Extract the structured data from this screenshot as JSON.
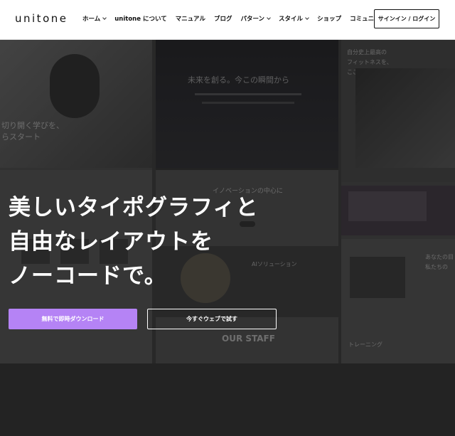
{
  "header": {
    "logo": "unitone",
    "nav": [
      {
        "label": "ホーム",
        "has_dropdown": true
      },
      {
        "label": "unitone について",
        "has_dropdown": false
      },
      {
        "label": "マニュアル",
        "has_dropdown": false
      },
      {
        "label": "ブログ",
        "has_dropdown": false
      },
      {
        "label": "パターン",
        "has_dropdown": true
      },
      {
        "label": "スタイル",
        "has_dropdown": true
      },
      {
        "label": "ショップ",
        "has_dropdown": false
      },
      {
        "label": "コミュニティ",
        "has_dropdown": true
      }
    ],
    "signin_label": "サインイン / ログイン"
  },
  "hero": {
    "headline": [
      "美しいタイポグラフィと",
      "自由なレイアウトを",
      "ノーコードで。"
    ],
    "primary_button": "無料で即時ダウンロード",
    "secondary_button": "今すぐウェブで試す",
    "background_texts": {
      "col1_a": "切り開く学びを、",
      "col1_b": "らスタート",
      "col2_a": "未来を創る。今この瞬間から",
      "col2_b": "イノベーションの中心に",
      "col2_c": "AIソリューション",
      "col2_d": "OUR STAFF",
      "col3_a": "自分史上最高の",
      "col3_b": "フィットネスを、",
      "col3_c": "ここで。",
      "col3_d": "あなたの目",
      "col3_e": "私たちの",
      "col3_f": "トレーニング"
    }
  },
  "colors": {
    "accent": "#b583f5",
    "header_bg": "#ffffff",
    "footer_bg": "#232323"
  }
}
